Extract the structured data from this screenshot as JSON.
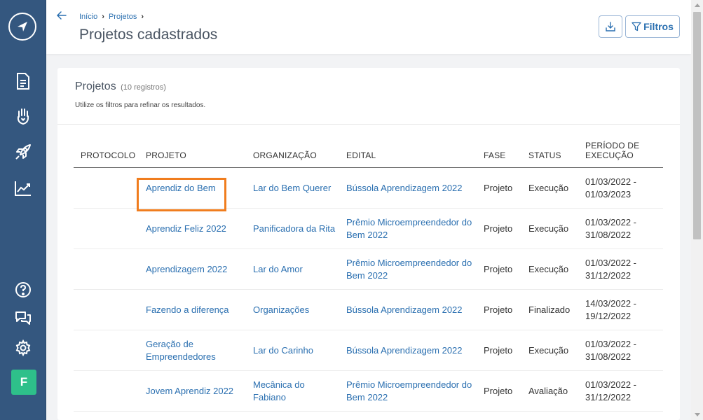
{
  "sidebar": {
    "logo_icon": "compass-logo-icon",
    "items": [
      {
        "name": "document-icon"
      },
      {
        "name": "hand-heart-icon"
      },
      {
        "name": "rocket-icon"
      },
      {
        "name": "chart-icon"
      }
    ],
    "bottom": [
      {
        "name": "help-icon"
      },
      {
        "name": "chat-icon"
      },
      {
        "name": "gear-icon"
      }
    ],
    "avatar_letter": "F",
    "colors": {
      "background": "#34577f",
      "avatar": "#2ec08a"
    }
  },
  "header": {
    "breadcrumb": [
      "Início",
      "Projetos"
    ],
    "title": "Projetos cadastrados",
    "filters_label": "Filtros"
  },
  "card": {
    "title": "Projetos",
    "count": "(10 registros)",
    "subtitle": "Utilize os filtros para refinar os resultados."
  },
  "table": {
    "headers": [
      "PROTOCOLO",
      "PROJETO",
      "ORGANIZAÇÃO",
      "EDITAL",
      "FASE",
      "STATUS",
      "PERÍODO DE EXECUÇÃO"
    ],
    "rows": [
      {
        "protocolo": "",
        "projeto": "Aprendiz do Bem",
        "organizacao": "Lar do Bem Querer",
        "edital": "Bússola Aprendizagem 2022",
        "fase": "Projeto",
        "status": "Execução",
        "periodo": "01/03/2022 - 01/03/2023"
      },
      {
        "protocolo": "",
        "projeto": "Aprendiz Feliz 2022",
        "organizacao": "Panificadora da Rita",
        "edital": "Prêmio Microempreendedor do Bem 2022",
        "fase": "Projeto",
        "status": "Execução",
        "periodo": "01/03/2022 - 31/08/2022"
      },
      {
        "protocolo": "",
        "projeto": "Aprendizagem 2022",
        "organizacao": "Lar do Amor",
        "edital": "Prêmio Microempreendedor do Bem 2022",
        "fase": "Projeto",
        "status": "Execução",
        "periodo": "01/03/2022 - 31/12/2022"
      },
      {
        "protocolo": "",
        "projeto": "Fazendo a diferença",
        "organizacao": "Organizações",
        "edital": "Bússola Aprendizagem 2022",
        "fase": "Projeto",
        "status": "Finalizado",
        "periodo": "14/03/2022 - 19/12/2022"
      },
      {
        "protocolo": "",
        "projeto": "Geração de Empreendedores",
        "organizacao": "Lar do Carinho",
        "edital": "Bússola Aprendizagem 2022",
        "fase": "Projeto",
        "status": "Execução",
        "periodo": "01/03/2022 - 31/08/2022"
      },
      {
        "protocolo": "",
        "projeto": "Jovem Aprendiz 2022",
        "organizacao": "Mecânica do Fabiano",
        "edital": "Prêmio Microempreendedor do Bem 2022",
        "fase": "Projeto",
        "status": "Avaliação",
        "periodo": "01/03/2022 - 31/12/2022"
      }
    ]
  },
  "colors": {
    "link": "#2a6fb0",
    "highlight": "#f07d1e"
  }
}
